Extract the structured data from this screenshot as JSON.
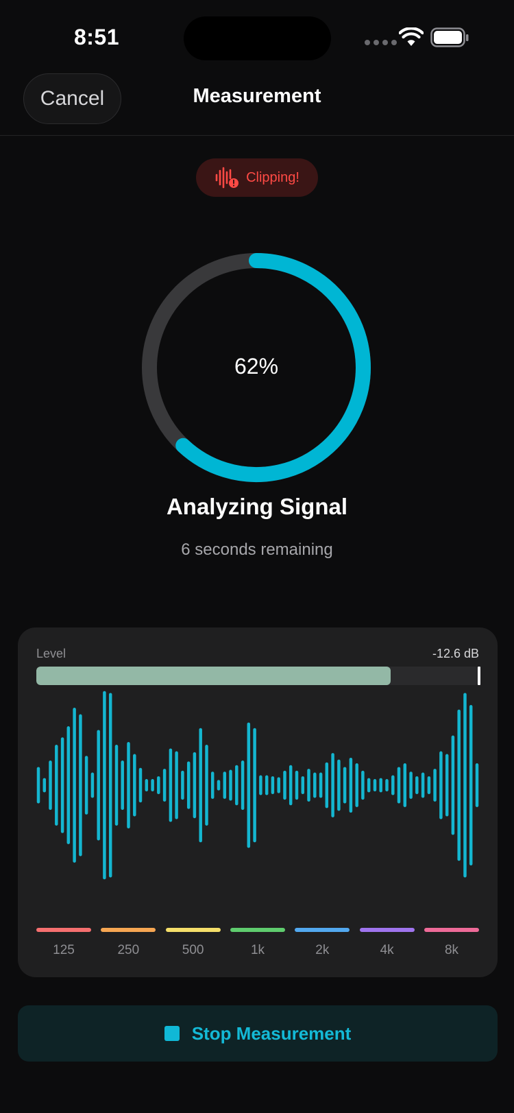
{
  "status_bar": {
    "time": "8:51"
  },
  "nav": {
    "cancel_label": "Cancel",
    "title": "Measurement"
  },
  "alert": {
    "label": "Clipping!",
    "color": "#ff4a45",
    "icon": "waveform-warning-icon"
  },
  "progress": {
    "percent_label": "62%",
    "value": 0.62,
    "accent": "#00b6d4"
  },
  "status": {
    "title": "Analyzing Signal",
    "remaining": "6 seconds remaining"
  },
  "level_meter": {
    "label": "Level",
    "value_label": "-12.6 dB",
    "fill_fraction": 0.8
  },
  "waveform": {
    "color": "#14b6d0",
    "amplitudes": [
      0.18,
      0.06,
      0.25,
      0.42,
      0.5,
      0.62,
      0.82,
      0.75,
      0.3,
      0.12,
      0.58,
      1.0,
      0.98,
      0.42,
      0.25,
      0.45,
      0.32,
      0.17,
      0.05,
      0.05,
      0.08,
      0.16,
      0.38,
      0.35,
      0.14,
      0.24,
      0.34,
      0.6,
      0.42,
      0.13,
      0.04,
      0.13,
      0.15,
      0.2,
      0.25,
      0.66,
      0.6,
      0.09,
      0.09,
      0.08,
      0.07,
      0.14,
      0.2,
      0.14,
      0.08,
      0.16,
      0.12,
      0.12,
      0.23,
      0.33,
      0.26,
      0.18,
      0.28,
      0.22,
      0.14,
      0.06,
      0.05,
      0.06,
      0.05,
      0.09,
      0.18,
      0.22,
      0.13,
      0.08,
      0.12,
      0.08,
      0.16,
      0.35,
      0.32,
      0.52,
      0.8,
      0.98,
      0.85,
      0.22
    ]
  },
  "bands": [
    {
      "label": "125",
      "color": "#f56f6f"
    },
    {
      "label": "250",
      "color": "#f6a652"
    },
    {
      "label": "500",
      "color": "#f5df6a"
    },
    {
      "label": "1k",
      "color": "#5fcc6e"
    },
    {
      "label": "2k",
      "color": "#52a8ef"
    },
    {
      "label": "4k",
      "color": "#9f74ee"
    },
    {
      "label": "8k",
      "color": "#ee6a98"
    }
  ],
  "stop": {
    "label": "Stop Measurement"
  }
}
